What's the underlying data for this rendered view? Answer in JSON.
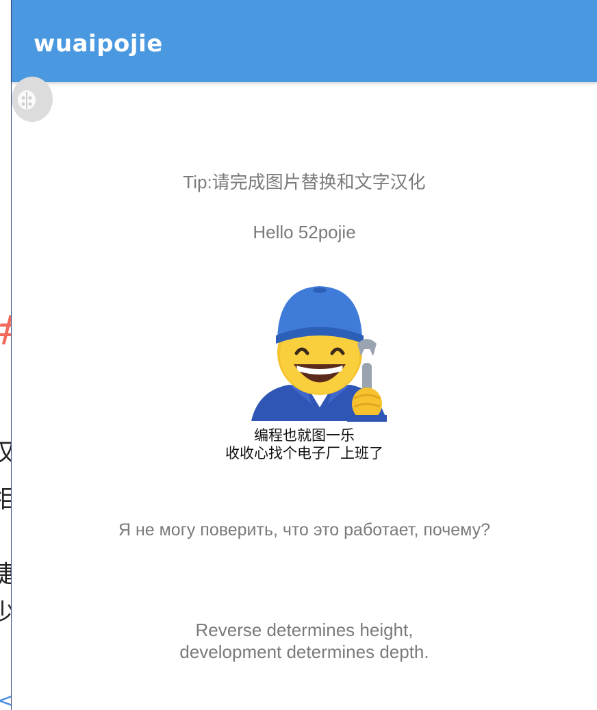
{
  "app": {
    "title": "wuaipojie"
  },
  "floating_button": {
    "icon": "bug-icon"
  },
  "content": {
    "tip": "Tip:请完成图片替换和文字汉化",
    "hello": "Hello 52pojie",
    "meme_caption_line1": "编程也就图一乐",
    "meme_caption_line2": "收收心找个电子厂上班了",
    "russian": "Я не могу поверить, что это работает, почему?",
    "motto_line1": "Reverse determines height,",
    "motto_line2": "development determines depth."
  },
  "colors": {
    "appbar": "#4a98e0",
    "body_text": "#7a7a7a",
    "background": "#ffffff"
  }
}
